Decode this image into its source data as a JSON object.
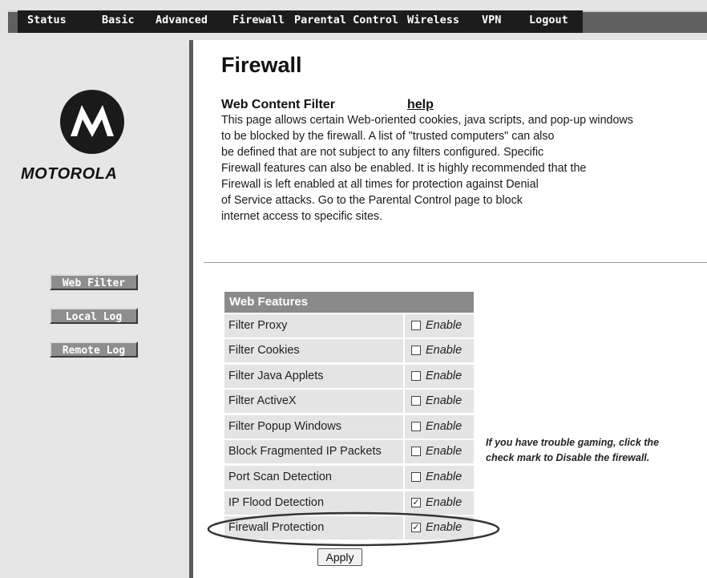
{
  "nav": {
    "items": [
      "Status",
      "Basic",
      "Advanced",
      "Firewall",
      "Parental Control",
      "Wireless",
      "VPN",
      "Logout"
    ]
  },
  "brand": {
    "name": "MOTOROLA"
  },
  "sidebar": {
    "buttons": [
      "Web Filter",
      "Local Log",
      "Remote Log"
    ]
  },
  "main": {
    "title": "Firewall",
    "section_title": "Web Content Filter",
    "help_label": "help",
    "description_lines": [
      "This page allows certain Web-oriented cookies, java scripts, and pop-up windows",
      "to be blocked by the firewall.  A list of \"trusted computers\" can also",
      "be defined that are not subject to any filters configured. Specific",
      "Firewall features can also be enabled.  It is highly recommended that the",
      "Firewall is left enabled at all times for protection against Denial",
      "of Service attacks. Go to the Parental Control page to block",
      "internet access to specific sites."
    ]
  },
  "table": {
    "header": "Web Features",
    "enable_label": "Enable",
    "rows": [
      {
        "label": "Filter Proxy",
        "checked": false
      },
      {
        "label": "Filter Cookies",
        "checked": false
      },
      {
        "label": "Filter Java Applets",
        "checked": false
      },
      {
        "label": "Filter ActiveX",
        "checked": false
      },
      {
        "label": "Filter Popup Windows",
        "checked": false
      },
      {
        "label": "Block Fragmented IP Packets",
        "checked": false
      },
      {
        "label": "Port Scan Detection",
        "checked": false
      },
      {
        "label": "IP Flood Detection",
        "checked": true
      },
      {
        "label": "Firewall Protection",
        "checked": true
      }
    ]
  },
  "note": {
    "lines": [
      "If you have trouble gaming, click the",
      "check mark to Disable the firewall."
    ]
  },
  "apply_label": "Apply",
  "colors": {
    "nav_background": "#1c1c1c",
    "sidebar_background": "#e6e6e6",
    "table_header": "#8a8a8a",
    "table_row": "#e4e4e4"
  }
}
